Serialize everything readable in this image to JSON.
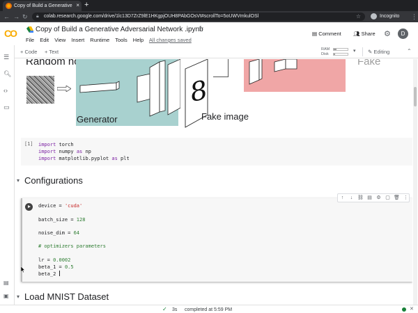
{
  "browser": {
    "tab_title": "Copy of Build a Generative",
    "tab_close": "×",
    "new_tab": "+",
    "url": "colab.research.google.com/drive/1lc13D7ZrZ9lE1HKgpjOUH8PAbGOsVt#scrollTo=5oUWVmkulOSl",
    "incognito_label": "Incognito"
  },
  "header": {
    "logo": "CO",
    "notebook_title": "Copy of Build a Generative Adversarial Network .ipynb",
    "menu": [
      "File",
      "Edit",
      "View",
      "Insert",
      "Runtime",
      "Tools",
      "Help"
    ],
    "save_status": "All changes saved",
    "comment_label": "Comment",
    "share_label": "Share",
    "avatar_letter": "D"
  },
  "toolbar": {
    "add_code": "+ Code",
    "add_text": "+ Text",
    "ram_label": "RAM",
    "disk_label": "Disk",
    "ram_usage": 0.2,
    "disk_usage": 0.1,
    "editing_label": "Editing"
  },
  "diagram": {
    "noise_label": "Random noise",
    "generator_label": "Generator",
    "fake_image_label": "Fake image",
    "fake_digit": "8",
    "fake_label_cut": "Fake"
  },
  "cells": {
    "imports": {
      "exec_count": "[1]",
      "lines": [
        {
          "kw": "import",
          "rest": " torch"
        },
        {
          "kw": "import",
          "rest": " numpy ",
          "kw2": "as",
          "rest2": " np"
        },
        {
          "kw": "import",
          "rest": " matplotlib.pyplot ",
          "kw2": "as",
          "rest2": " plt"
        }
      ]
    },
    "config": {
      "device_var": "device = ",
      "device_val": "'cuda'",
      "batch_var": "batch_size = ",
      "batch_val": "128",
      "noise_var": "noise_dim = ",
      "noise_val": "64",
      "comment": "# optimizers parameters",
      "lr_var": "lr = ",
      "lr_val": "0.0002",
      "beta1_var": "beta_1 = ",
      "beta1_val": "0.5",
      "beta2_var": "beta_2 "
    },
    "cell_tools": [
      "↑",
      "↓",
      "⛓",
      "▤",
      "⚙",
      "▢",
      "🗑",
      "⋮"
    ]
  },
  "sections": {
    "configurations": "Configurations",
    "mnist": "Load MNIST Dataset"
  },
  "status": {
    "duration": "3s",
    "text": "completed at 5:59 PM"
  },
  "colors": {
    "generator_bg": "#a8d1cf",
    "discriminator_bg": "#f0a6a6",
    "logo": "#f9ab00"
  }
}
